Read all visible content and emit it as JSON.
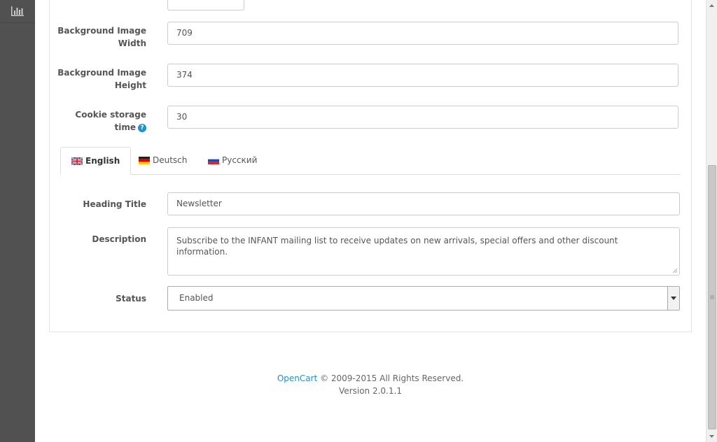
{
  "sidebar": {
    "icon": "bar-chart-icon"
  },
  "form": {
    "bg_width": {
      "label": "Background Image Width",
      "value": "709"
    },
    "bg_height": {
      "label": "Background Image Height",
      "value": "374"
    },
    "cookie_time": {
      "label": "Cookie storage time",
      "value": "30",
      "help_icon": "question-circle-icon"
    }
  },
  "tabs": [
    {
      "label": "English",
      "flag": "flag-gb-icon"
    },
    {
      "label": "Deutsch",
      "flag": "flag-de-icon"
    },
    {
      "label": "Русский",
      "flag": "flag-ru-icon"
    }
  ],
  "lang_fields": {
    "heading_title": {
      "label": "Heading Title",
      "value": "Newsletter"
    },
    "description": {
      "label": "Description",
      "value": "Subscribe to the INFANT mailing list to receive updates on new arrivals,  special offers and other discount information."
    },
    "status": {
      "label": "Status",
      "value": "Enabled"
    }
  },
  "footer": {
    "brand": "OpenCart",
    "copyright": " © 2009-2015 All Rights Reserved.",
    "version": "Version 2.0.1.1"
  },
  "colors": {
    "accent": "#1e91cf",
    "sidebar": "#515151"
  }
}
